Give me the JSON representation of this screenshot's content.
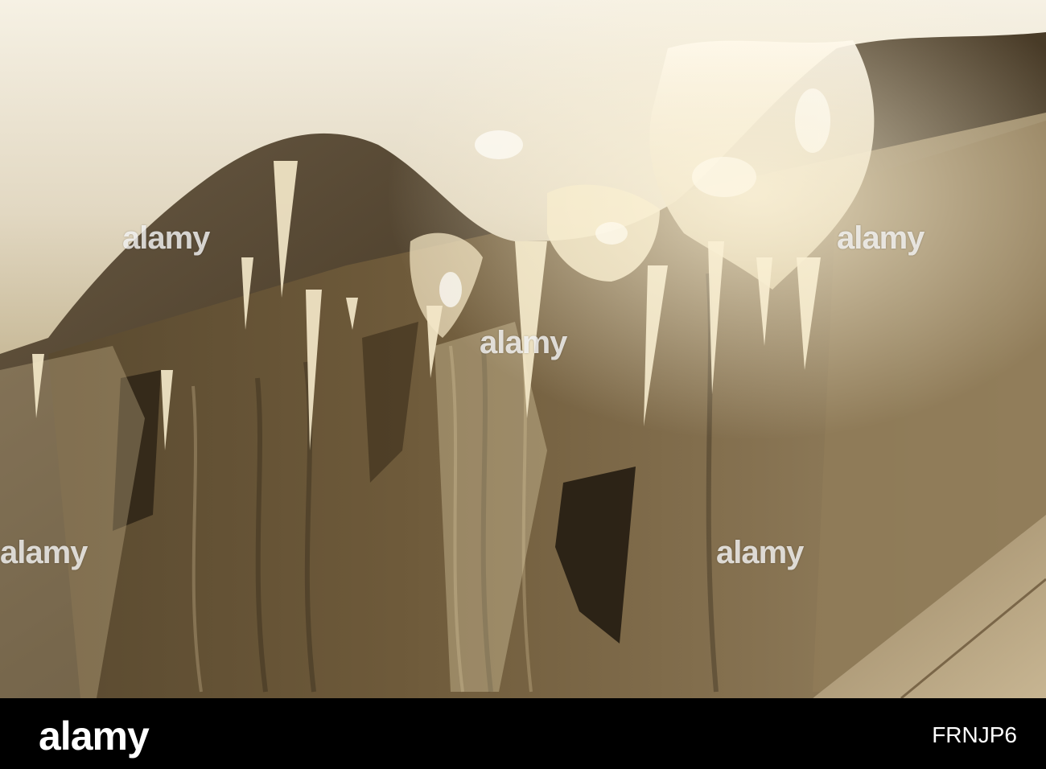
{
  "photo": {
    "description_icon": "icicles-photo",
    "watermark_text": "alamy"
  },
  "footer": {
    "logo_text": "alamy",
    "image_id": "FRNJP6",
    "background_color": "#000000",
    "text_color": "#ffffff"
  },
  "colors": {
    "ice_highlight": "#f4ead2",
    "stone_dark": "#3a3022",
    "stone_warm": "#8a7452",
    "stone_light": "#b09a76"
  }
}
